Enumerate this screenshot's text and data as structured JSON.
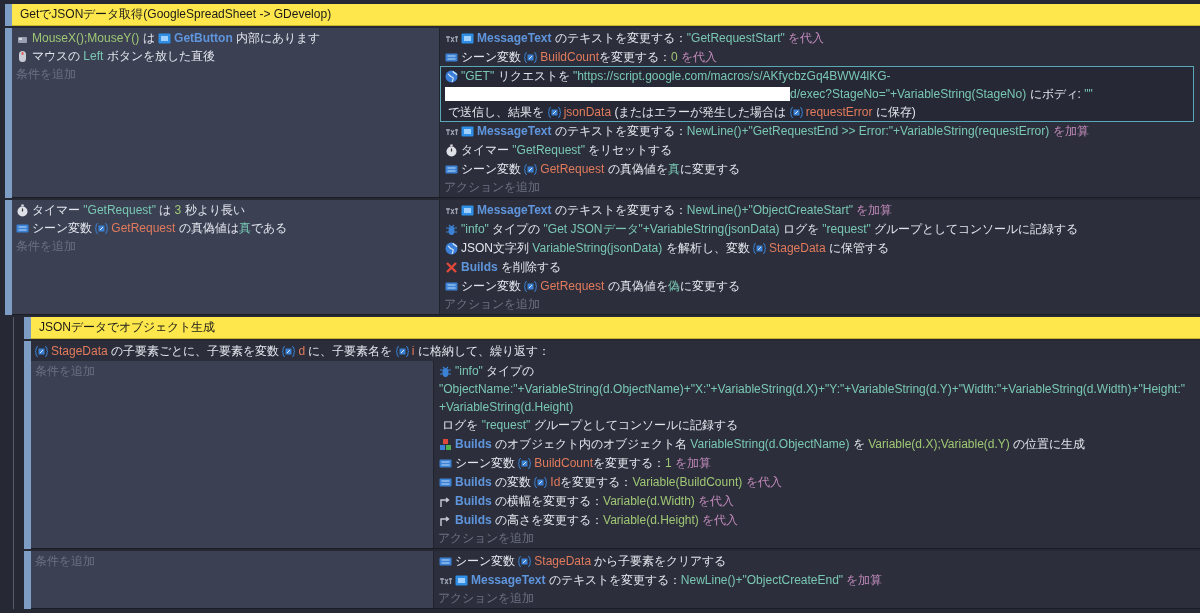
{
  "groups": [
    {
      "title": "GetでJSONデータ取得(GoogleSpreadSheet -> GDevelop)",
      "events": [
        {
          "conditions": [
            {
              "kind": "cursor",
              "parts": [
                {
                  "kind": "num",
                  "text": "MouseX();MouseY()"
                },
                {
                  "kind": "plain",
                  "text": " は "
                },
                {
                  "kind": "objicon",
                  "text": "GetButton"
                },
                {
                  "kind": "plain",
                  "text": " 内部にあります"
                }
              ]
            },
            {
              "kind": "mouse",
              "parts": [
                {
                  "kind": "plain",
                  "text": "マウスの "
                },
                {
                  "kind": "str",
                  "text": "Left"
                },
                {
                  "kind": "plain",
                  "text": " ボタンを放した直後"
                }
              ]
            }
          ],
          "add_condition": "条件を追加",
          "actions": [
            {
              "kind": "text",
              "selected": false,
              "parts": [
                {
                  "kind": "objicon",
                  "text": "MessageText"
                },
                {
                  "kind": "plain",
                  "text": " のテキストを変更する："
                },
                {
                  "kind": "str",
                  "text": "\"GetRequestStart\""
                },
                {
                  "kind": "op",
                  "text": " を代入"
                }
              ]
            },
            {
              "kind": "variable",
              "selected": false,
              "parts": [
                {
                  "kind": "plain",
                  "text": "シーン変数 "
                },
                {
                  "kind": "var",
                  "text": "BuildCount"
                },
                {
                  "kind": "plain",
                  "text": "を変更する："
                },
                {
                  "kind": "num",
                  "text": "0"
                },
                {
                  "kind": "op",
                  "text": " を代入"
                }
              ]
            },
            {
              "kind": "network",
              "selected": true,
              "parts": [
                {
                  "kind": "str",
                  "text": "\"GET\""
                },
                {
                  "kind": "plain",
                  "text": " リクエストを "
                },
                {
                  "kind": "str",
                  "text": "\"https://script.google.com/macros/s/AKfycbzGq4BWW4lKG-"
                },
                {
                  "kind": "redacted"
                },
                {
                  "kind": "str",
                  "text": "d/exec?StageNo=\"+VariableString(StageNo)"
                },
                {
                  "kind": "plain",
                  "text": " にボディ: "
                },
                {
                  "kind": "str",
                  "text": "\"\""
                },
                {
                  "kind": "plain",
                  "text": " で送信し、結果を "
                },
                {
                  "kind": "var",
                  "text": "jsonData"
                },
                {
                  "kind": "plain",
                  "text": " (またはエラーが発生した場合は "
                },
                {
                  "kind": "var",
                  "text": "requestError"
                },
                {
                  "kind": "plain",
                  "text": " に保存)"
                }
              ]
            },
            {
              "kind": "text",
              "selected": false,
              "parts": [
                {
                  "kind": "objicon",
                  "text": "MessageText"
                },
                {
                  "kind": "plain",
                  "text": " のテキストを変更する："
                },
                {
                  "kind": "str",
                  "text": "NewLine()+\"GetRequestEnd >> Error:\"+VariableString(requestError)"
                },
                {
                  "kind": "op",
                  "text": " を加算"
                }
              ]
            },
            {
              "kind": "timer",
              "selected": false,
              "parts": [
                {
                  "kind": "plain",
                  "text": "タイマー "
                },
                {
                  "kind": "str",
                  "text": "\"GetRequest\""
                },
                {
                  "kind": "plain",
                  "text": " をリセットする"
                }
              ]
            },
            {
              "kind": "variable",
              "selected": false,
              "parts": [
                {
                  "kind": "plain",
                  "text": "シーン変数 "
                },
                {
                  "kind": "var",
                  "text": "GetRequest"
                },
                {
                  "kind": "plain",
                  "text": " の真偽値を"
                },
                {
                  "kind": "str",
                  "text": "真"
                },
                {
                  "kind": "plain",
                  "text": "に変更する"
                }
              ]
            }
          ],
          "add_action": "アクションを追加"
        },
        {
          "conditions": [
            {
              "kind": "timer",
              "parts": [
                {
                  "kind": "plain",
                  "text": "タイマー "
                },
                {
                  "kind": "str",
                  "text": "\"GetRequest\""
                },
                {
                  "kind": "plain",
                  "text": " は "
                },
                {
                  "kind": "num",
                  "text": "3"
                },
                {
                  "kind": "plain",
                  "text": " 秒より長い"
                }
              ]
            },
            {
              "kind": "variable",
              "parts": [
                {
                  "kind": "plain",
                  "text": "シーン変数 "
                },
                {
                  "kind": "var",
                  "text": "GetRequest"
                },
                {
                  "kind": "plain",
                  "text": " の真偽値は"
                },
                {
                  "kind": "str",
                  "text": "真"
                },
                {
                  "kind": "plain",
                  "text": "である"
                }
              ]
            }
          ],
          "add_condition": "条件を追加",
          "actions": [
            {
              "kind": "text",
              "selected": false,
              "parts": [
                {
                  "kind": "objicon",
                  "text": "MessageText"
                },
                {
                  "kind": "plain",
                  "text": " のテキストを変更する："
                },
                {
                  "kind": "str",
                  "text": "NewLine()+\"ObjectCreateStart\""
                },
                {
                  "kind": "op",
                  "text": " を加算"
                }
              ]
            },
            {
              "kind": "debug",
              "selected": false,
              "parts": [
                {
                  "kind": "str",
                  "text": "\"info\""
                },
                {
                  "kind": "plain",
                  "text": " タイプの "
                },
                {
                  "kind": "str",
                  "text": "\"Get JSONデータ\"+VariableString(jsonData)"
                },
                {
                  "kind": "plain",
                  "text": " ログを "
                },
                {
                  "kind": "str",
                  "text": "\"request\""
                },
                {
                  "kind": "plain",
                  "text": " グループとしてコンソールに記録する"
                }
              ]
            },
            {
              "kind": "network",
              "selected": false,
              "parts": [
                {
                  "kind": "plain",
                  "text": "JSON文字列 "
                },
                {
                  "kind": "str",
                  "text": "VariableString(jsonData)"
                },
                {
                  "kind": "plain",
                  "text": " を解析し、変数 "
                },
                {
                  "kind": "var",
                  "text": "StageData"
                },
                {
                  "kind": "plain",
                  "text": " に保管する"
                }
              ]
            },
            {
              "kind": "delete",
              "selected": false,
              "parts": [
                {
                  "kind": "obj",
                  "text": "Builds"
                },
                {
                  "kind": "plain",
                  "text": " を削除する"
                }
              ]
            },
            {
              "kind": "variable",
              "selected": false,
              "parts": [
                {
                  "kind": "plain",
                  "text": "シーン変数 "
                },
                {
                  "kind": "var",
                  "text": "GetRequest"
                },
                {
                  "kind": "plain",
                  "text": " の真偽値を"
                },
                {
                  "kind": "str",
                  "text": "偽"
                },
                {
                  "kind": "plain",
                  "text": "に変更する"
                }
              ]
            }
          ],
          "add_action": "アクションを追加"
        }
      ]
    },
    {
      "title": "JSONデータでオブジェクト生成",
      "events": [
        {
          "header": [
            {
              "kind": "var",
              "text": "StageData"
            },
            {
              "kind": "plain",
              "text": " の子要素ごとに、子要素を変数 "
            },
            {
              "kind": "var",
              "text": "d"
            },
            {
              "kind": "plain",
              "text": " に、子要素名を "
            },
            {
              "kind": "var",
              "text": "i"
            },
            {
              "kind": "plain",
              "text": " に格納して、繰り返す："
            }
          ],
          "add_condition": "条件を追加",
          "actions": [
            {
              "kind": "debug",
              "selected": false,
              "parts": [
                {
                  "kind": "str",
                  "text": "\"info\""
                },
                {
                  "kind": "plain",
                  "text": " タイプの "
                },
                {
                  "kind": "str",
                  "text": "\"ObjectName:\"+VariableString(d.ObjectName)+\"X:\"+VariableString(d.X)+\"Y:\"+VariableString(d.Y)+\"Width:\"+VariableString(d.Width)+\"Height:\"+VariableString(d.Height)"
                },
                {
                  "kind": "plain",
                  "text": " ログを "
                },
                {
                  "kind": "str",
                  "text": "\"request\""
                },
                {
                  "kind": "plain",
                  "text": " グループとしてコンソールに記録する"
                }
              ]
            },
            {
              "kind": "create",
              "selected": false,
              "parts": [
                {
                  "kind": "obj",
                  "text": "Builds"
                },
                {
                  "kind": "plain",
                  "text": " のオブジェクト内のオブジェクト名 "
                },
                {
                  "kind": "str",
                  "text": "VariableString(d.ObjectName)"
                },
                {
                  "kind": "plain",
                  "text": " を "
                },
                {
                  "kind": "num",
                  "text": "Variable(d.X);Variable(d.Y)"
                },
                {
                  "kind": "plain",
                  "text": " の位置に生成"
                }
              ]
            },
            {
              "kind": "variable",
              "selected": false,
              "parts": [
                {
                  "kind": "plain",
                  "text": "シーン変数 "
                },
                {
                  "kind": "var",
                  "text": "BuildCount"
                },
                {
                  "kind": "plain",
                  "text": "を変更する："
                },
                {
                  "kind": "num",
                  "text": "1"
                },
                {
                  "kind": "op",
                  "text": " を加算"
                }
              ]
            },
            {
              "kind": "variable",
              "selected": false,
              "parts": [
                {
                  "kind": "obj",
                  "text": "Builds"
                },
                {
                  "kind": "plain",
                  "text": " の変数 "
                },
                {
                  "kind": "var",
                  "text": "Id"
                },
                {
                  "kind": "plain",
                  "text": "を変更する："
                },
                {
                  "kind": "num",
                  "text": "Variable(BuildCount)"
                },
                {
                  "kind": "op",
                  "text": " を代入"
                }
              ]
            },
            {
              "kind": "resize",
              "selected": false,
              "parts": [
                {
                  "kind": "obj",
                  "text": "Builds"
                },
                {
                  "kind": "plain",
                  "text": " の横幅を変更する："
                },
                {
                  "kind": "num",
                  "text": "Variable(d.Width)"
                },
                {
                  "kind": "op",
                  "text": " を代入"
                }
              ]
            },
            {
              "kind": "resize",
              "selected": false,
              "parts": [
                {
                  "kind": "obj",
                  "text": "Builds"
                },
                {
                  "kind": "plain",
                  "text": " の高さを変更する："
                },
                {
                  "kind": "num",
                  "text": "Variable(d.Height)"
                },
                {
                  "kind": "op",
                  "text": " を代入"
                }
              ]
            }
          ],
          "add_action": "アクションを追加"
        },
        {
          "add_condition": "条件を追加",
          "actions": [
            {
              "kind": "variable",
              "selected": false,
              "parts": [
                {
                  "kind": "plain",
                  "text": "シーン変数 "
                },
                {
                  "kind": "var",
                  "text": "StageData"
                },
                {
                  "kind": "plain",
                  "text": " から子要素をクリアする"
                }
              ]
            },
            {
              "kind": "text",
              "selected": false,
              "parts": [
                {
                  "kind": "objicon",
                  "text": "MessageText"
                },
                {
                  "kind": "plain",
                  "text": " のテキストを変更する："
                },
                {
                  "kind": "str",
                  "text": "NewLine()+\"ObjectCreateEnd\""
                },
                {
                  "kind": "op",
                  "text": " を加算"
                }
              ]
            }
          ],
          "add_action": "アクションを追加"
        }
      ]
    }
  ]
}
